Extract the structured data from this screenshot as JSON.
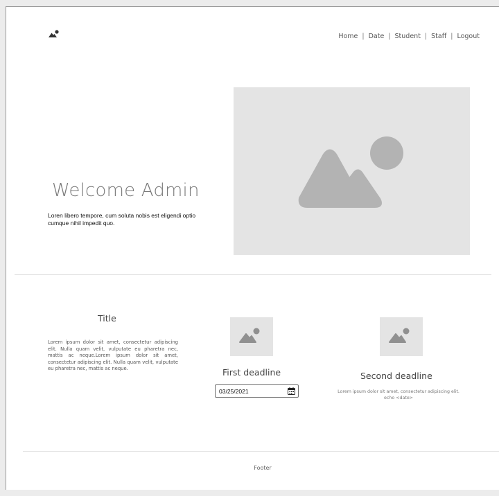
{
  "header": {
    "logo_icon": "image-icon",
    "nav": [
      {
        "label": "Home"
      },
      {
        "label": "Date"
      },
      {
        "label": "Student"
      },
      {
        "label": "Staff"
      },
      {
        "label": "Logout"
      }
    ]
  },
  "hero": {
    "title": "Welcome Admin",
    "text": "Loren libero tempore, cum soluta nobis est eligendi optio cumque nihil impedit quo.",
    "image_icon": "image-placeholder-icon"
  },
  "columns": {
    "left": {
      "title": "Title",
      "text": "Lorem ipsum dolor sit amet, consectetur adipiscing elit. Nulla quam velit, vulputate eu pharetra nec, mattis ac neque.Lorem ipsum dolor sit amet, consectetur adipiscing elit. Nulla quam velit, vulputate eu pharetra nec, mattis ac neque."
    },
    "first_deadline": {
      "label": "First deadline",
      "date_value": "03/25/2021",
      "calendar_icon": "calendar-icon"
    },
    "second_deadline": {
      "label": "Second deadline",
      "text": "Lorem ipsum dolor sit amet, consectetur adipiscing elit. echo <date>"
    }
  },
  "footer": {
    "text": "Footer"
  },
  "colors": {
    "placeholder_bg": "#e4e4e4",
    "placeholder_icon": "#b3b3b3",
    "page_bg": "#ececec"
  }
}
